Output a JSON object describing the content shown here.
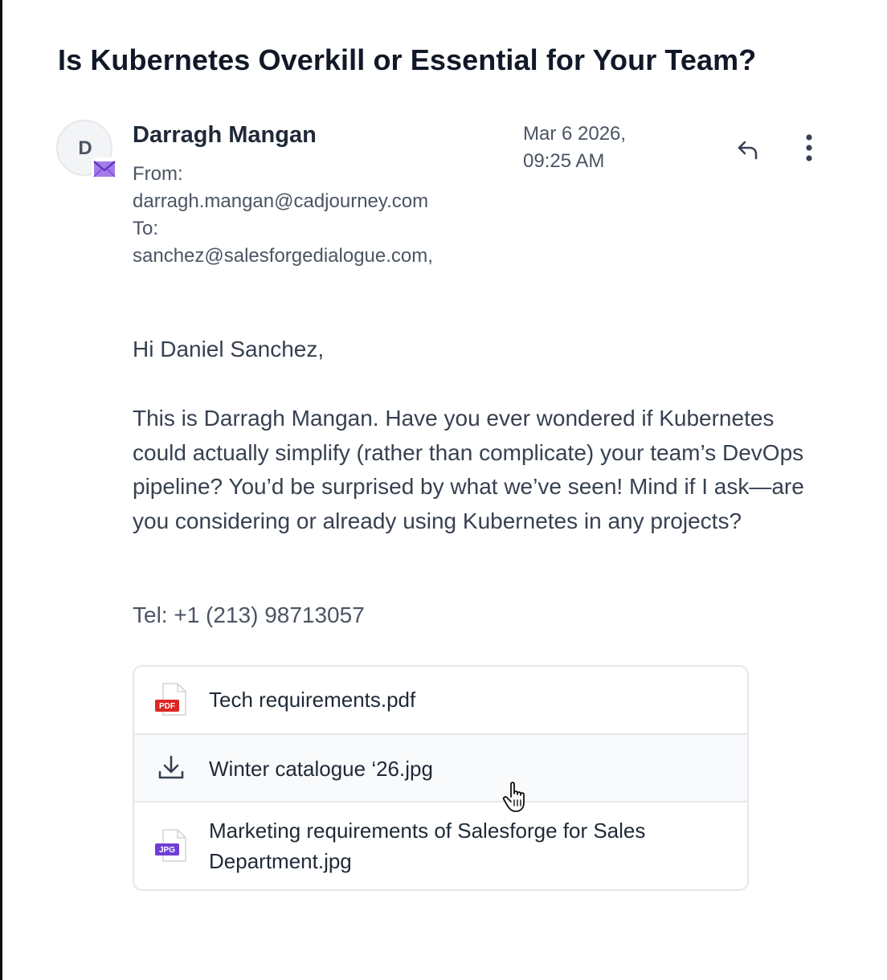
{
  "email": {
    "subject": "Is Kubernetes Overkill or Essential for Your Team?",
    "sender": {
      "avatar_letter": "D",
      "avatar_badge_icon": "envelope-icon",
      "name": "Darragh Mangan",
      "from_label": "From:",
      "from_email": "darragh.mangan@cadjourney.com",
      "to_label": "To:",
      "to_email": "sanchez@salesforgedialogue.com,"
    },
    "date_line1": "Mar 6 2026,",
    "date_line2": "09:25 AM",
    "actions": {
      "reply_icon": "reply-icon",
      "more_icon": "more-vertical-icon"
    },
    "body": {
      "greeting": "Hi Daniel Sanchez,",
      "paragraph": "This is Darragh Mangan. Have you ever wondered if Kubernetes could actually simplify (rather than complicate) your team’s DevOps pipeline? You’d be surprised by what we’ve seen! Mind if I ask—are you considering or already using Kubernetes in any projects?",
      "tel": "Tel: +1 (213) 98713057"
    },
    "attachments": [
      {
        "name": "Tech requirements.pdf",
        "icon": "pdf-file-icon",
        "badge": "PDF"
      },
      {
        "name": "Winter catalogue ‘26.jpg",
        "icon": "download-icon"
      },
      {
        "name": "Marketing requirements of Salesforge for Sales Department.jpg",
        "icon": "jpg-file-icon",
        "badge": "JPG"
      }
    ]
  },
  "colors": {
    "pdf_badge": "#dc2626",
    "jpg_badge": "#6d3fd6",
    "envelope_badge": "#7c4ddb",
    "hover_row": "#f9fafb"
  }
}
